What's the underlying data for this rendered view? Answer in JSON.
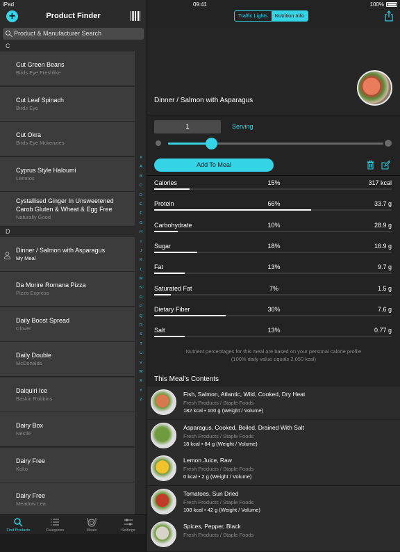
{
  "status_bar": {
    "device": "iPad",
    "time": "09:41",
    "battery": "100%"
  },
  "left_panel": {
    "title": "Product Finder",
    "search_placeholder": "Product & Manufacturer Search",
    "sections": [
      {
        "letter": "C",
        "items": [
          {
            "name": "Cut Green Beans",
            "brand": "Birds Eye Freshlike"
          },
          {
            "name": "Cut Leaf Spinach",
            "brand": "Birds Eye"
          },
          {
            "name": "Cut Okra",
            "brand": "Birds Eye Mckenzies"
          },
          {
            "name": "Cyprus Style Haloumi",
            "brand": "Lemnos"
          },
          {
            "name": "Cystallised Ginger In Unsweetened Carob Gluten & Wheat & Egg Free",
            "brand": "Naturally Good"
          }
        ]
      },
      {
        "letter": "D",
        "items": [
          {
            "name": "Dinner / Salmon with Asparagus",
            "brand": "My Meal",
            "is_meal": true
          },
          {
            "name": "Da Morire Romana Pizza",
            "brand": "Pizza Express"
          },
          {
            "name": "Daily Boost Spread",
            "brand": "Clover"
          },
          {
            "name": "Daily Double",
            "brand": "McDonalds"
          },
          {
            "name": "Daiquiri Ice",
            "brand": "Baskin Robbins"
          },
          {
            "name": "Dairy Box",
            "brand": "Nestle"
          },
          {
            "name": "Dairy Free",
            "brand": "Koko"
          },
          {
            "name": "Dairy Free",
            "brand": "Meadow Lea"
          }
        ]
      }
    ],
    "index_letters": [
      "#",
      "A",
      "B",
      "C",
      "D",
      "E",
      "F",
      "G",
      "H",
      "I",
      "J",
      "K",
      "L",
      "M",
      "N",
      "O",
      "P",
      "Q",
      "R",
      "S",
      "T",
      "U",
      "V",
      "W",
      "X",
      "Y",
      "Z"
    ],
    "tabs": [
      {
        "label": "Find Products",
        "icon": "search-icon",
        "active": true
      },
      {
        "label": "Categories",
        "icon": "list-icon",
        "active": false
      },
      {
        "label": "Meals",
        "icon": "meals-icon",
        "active": false
      },
      {
        "label": "Settings",
        "icon": "settings-icon",
        "active": false
      }
    ]
  },
  "right_panel": {
    "segments": [
      {
        "label": "Traffic Lights",
        "active": false
      },
      {
        "label": "Nutrition Info",
        "active": true
      }
    ],
    "meal_title": "Dinner / Salmon with Asparagus",
    "quantity": "1",
    "unit": "Serving",
    "slider_value_fraction": 0.2,
    "add_button": "Add To Meal",
    "nutrients": [
      {
        "name": "Calories",
        "percent": "15%",
        "value": "317 kcal",
        "fraction": 0.15
      },
      {
        "name": "Protein",
        "percent": "66%",
        "value": "33.7 g",
        "fraction": 0.66
      },
      {
        "name": "Carbohydrate",
        "percent": "10%",
        "value": "28.9 g",
        "fraction": 0.1
      },
      {
        "name": "Sugar",
        "percent": "18%",
        "value": "16.9 g",
        "fraction": 0.18
      },
      {
        "name": "Fat",
        "percent": "13%",
        "value": "9.7 g",
        "fraction": 0.13
      },
      {
        "name": "Saturated Fat",
        "percent": "7%",
        "value": "1.5 g",
        "fraction": 0.07
      },
      {
        "name": "Dietary Fiber",
        "percent": "30%",
        "value": "7.6 g",
        "fraction": 0.3
      },
      {
        "name": "Salt",
        "percent": "13%",
        "value": "0.77 g",
        "fraction": 0.13
      }
    ],
    "note_line1": "Nutrient percentages for this meal are based on your personal calorie profile",
    "note_line2": "(100% daily value equals 2,050 kcal)",
    "contents_title": "This Meal's Contents",
    "contents": [
      {
        "name": "Fish, Salmon, Atlantic, Wild, Cooked, Dry Heat",
        "category": "Fresh Products / Staple Foods",
        "detail": "182 kcal  •  100 g (Weight / Volume)",
        "color": "#d9774f"
      },
      {
        "name": "Asparagus, Cooked, Boiled, Drained With Salt",
        "category": "Fresh Products / Staple Foods",
        "detail": "18 kcal  •  84 g (Weight / Volume)",
        "color": "#6f9a3e"
      },
      {
        "name": "Lemon Juice, Raw",
        "category": "Fresh Products / Staple Foods",
        "detail": "0 kcal  •  2 g (Weight / Volume)",
        "color": "#f2c12e"
      },
      {
        "name": "Tomatoes, Sun Dried",
        "category": "Fresh Products / Staple Foods",
        "detail": "108 kcal  •  42 g (Weight / Volume)",
        "color": "#c23a2a"
      },
      {
        "name": "Spices, Pepper, Black",
        "category": "Fresh Products / Staple Foods",
        "detail": "",
        "color": "#d8d2c8"
      }
    ]
  }
}
